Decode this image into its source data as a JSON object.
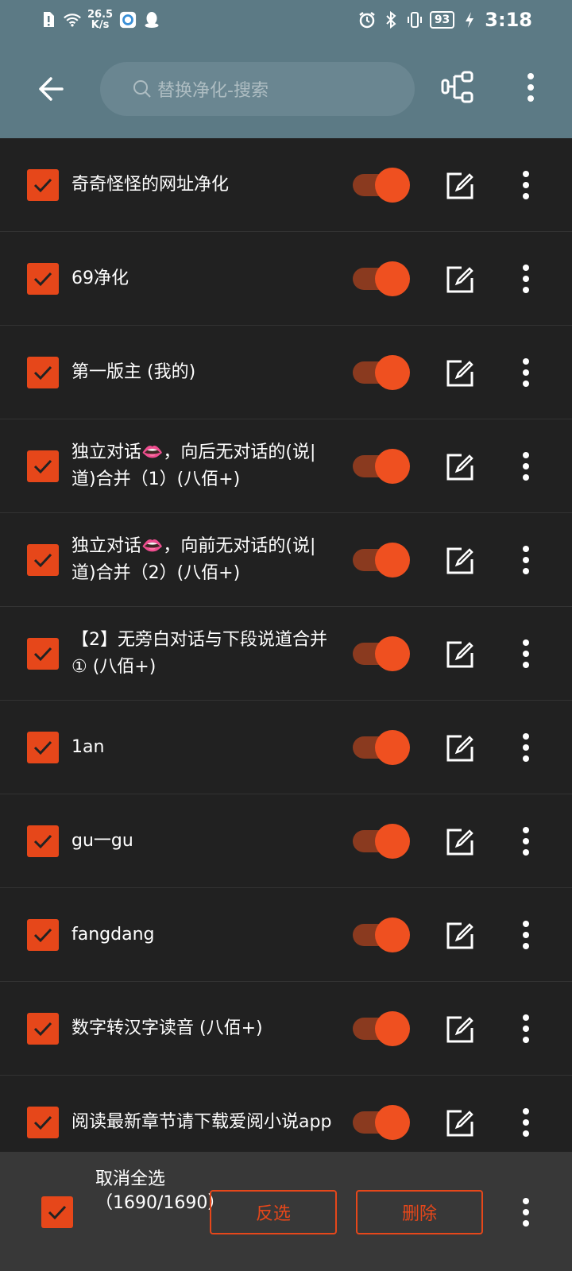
{
  "status_bar": {
    "net_speed_value": "26.5",
    "net_speed_unit": "K/s",
    "battery": "93",
    "time": "3:18"
  },
  "app_bar": {
    "search_placeholder": "替换净化-搜索"
  },
  "rules": [
    {
      "name": "奇奇怪怪的网址净化",
      "checked": true,
      "enabled": true
    },
    {
      "name": "69净化",
      "checked": true,
      "enabled": true
    },
    {
      "name": "第一版主 (我的)",
      "checked": true,
      "enabled": true
    },
    {
      "name": "独立对话👄，向后无对话的(说|道)合并（1）(八佰+)",
      "checked": true,
      "enabled": true
    },
    {
      "name": "独立对话👄，向前无对话的(说|道)合并（2）(八佰+)",
      "checked": true,
      "enabled": true
    },
    {
      "name": "【2】无旁白对话与下段说道合并① (八佰+)",
      "checked": true,
      "enabled": true
    },
    {
      "name": "1an",
      "checked": true,
      "enabled": true
    },
    {
      "name": "gu一gu",
      "checked": true,
      "enabled": true
    },
    {
      "name": "fangdang",
      "checked": true,
      "enabled": true
    },
    {
      "name": "数字转汉字读音 (八佰+)",
      "checked": true,
      "enabled": true
    },
    {
      "name": "阅读最新章节请下载爱阅小说app",
      "checked": true,
      "enabled": true
    }
  ],
  "bottom_bar": {
    "select_label": "取消全选（1690/1690）",
    "invert_label": "反选",
    "delete_label": "删除"
  },
  "colors": {
    "accent": "#e6471a",
    "header": "#5c7a85",
    "background": "#212121",
    "bottom_bar": "#383838"
  }
}
